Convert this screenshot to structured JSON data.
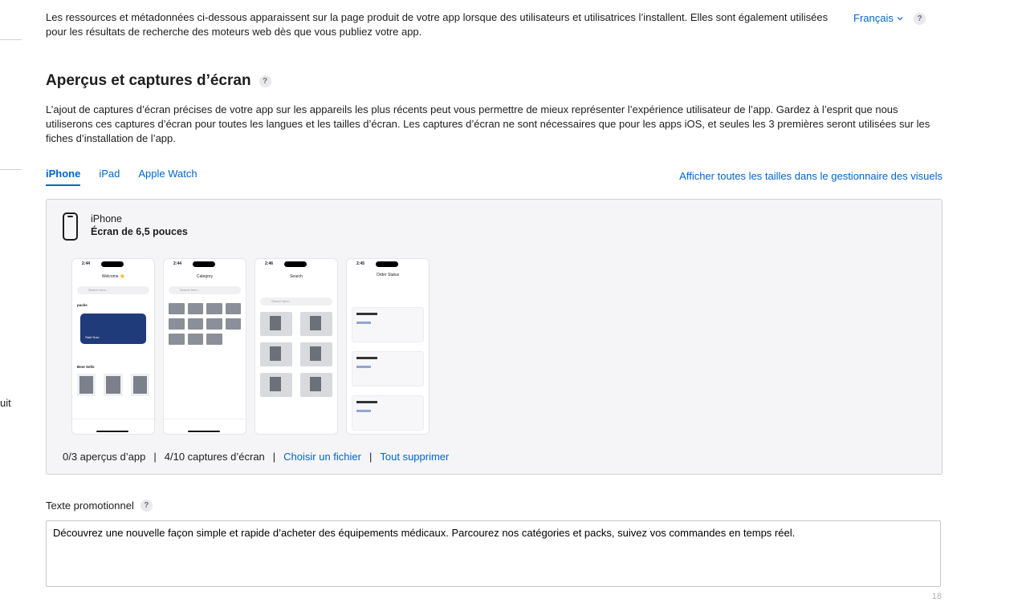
{
  "sidebar": {
    "fragment_text": "uit"
  },
  "intro": {
    "text": "Les ressources et métadonnées ci-dessous apparaissent sur la page produit de votre app lorsque des utilisateurs et utilisatrices l’installent. Elles sont également utilisées pour les résultats de recherche des moteurs web dès que vous publiez votre app.",
    "language": "Français",
    "help": "?"
  },
  "section": {
    "title": "Aperçus et captures d’écran",
    "help": "?",
    "description": "L’ajout de captures d’écran précises de votre app sur les appareils les plus récents peut vous permettre de mieux représenter l’expérience utilisateur de l’app. Gardez à l’esprit que nous utiliserons ces captures d’écran pour toutes les langues et les tailles d’écran. Les captures d’écran ne sont nécessaires que pour les apps iOS, et seules les 3 premières seront utilisées sur les fiches d’installation de l’app."
  },
  "tabs": [
    {
      "label": "iPhone",
      "active": true
    },
    {
      "label": "iPad",
      "active": false
    },
    {
      "label": "Apple Watch",
      "active": false
    }
  ],
  "view_all_link": "Afficher toutes les tailles dans le gestionnaire des visuels",
  "device": {
    "name": "iPhone",
    "screen": "Écran de 6,5 pouces"
  },
  "screenshots": [
    {
      "time": "2:44",
      "header": "Welcome 👋",
      "search": "Search here...",
      "banner_text": "Start Now",
      "section1": "packs",
      "section2": "Best Sells"
    },
    {
      "time": "2:44",
      "header": "Category",
      "search": "Search here..."
    },
    {
      "time": "2:46",
      "header": "Search",
      "search": "Search here..."
    },
    {
      "time": "2:45",
      "header": "Order Status"
    }
  ],
  "counts": {
    "previews": "0/3 aperçus d’app",
    "screenshots": "4/10 captures d’écran",
    "choose_file": "Choisir un fichier",
    "delete_all": "Tout supprimer",
    "separator": "|"
  },
  "promo": {
    "label": "Texte promotionnel",
    "help": "?",
    "value": "Découvrez une nouvelle façon simple et rapide d’acheter des équipements médicaux. Parcourez nos catégories et packs, suivez vos commandes en temps réel.",
    "counter": "18"
  },
  "colors": {
    "link": "#0066cc",
    "panel_bg": "#f5f5f7",
    "text": "#1d1d1f"
  }
}
